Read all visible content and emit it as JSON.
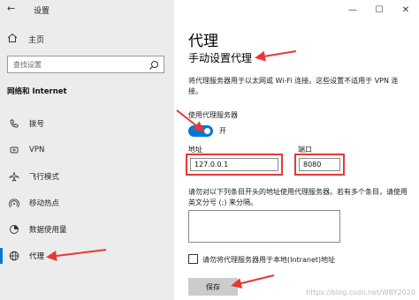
{
  "window": {
    "app_title": "设置",
    "controls": [
      "minimize-icon",
      "maximize-icon",
      "close-icon"
    ]
  },
  "sidebar": {
    "home_label": "主页",
    "search_placeholder": "查找设置",
    "section_title": "网络和 Internet",
    "items": [
      {
        "label": "拨号",
        "icon": "dialup-icon"
      },
      {
        "label": "VPN",
        "icon": "vpn-icon"
      },
      {
        "label": "飞行模式",
        "icon": "airplane-icon"
      },
      {
        "label": "移动热点",
        "icon": "hotspot-icon"
      },
      {
        "label": "数据使用量",
        "icon": "data-usage-icon"
      },
      {
        "label": "代理",
        "icon": "globe-icon",
        "active": true
      }
    ]
  },
  "main": {
    "title": "代理",
    "subtitle": "手动设置代理",
    "description": "将代理服务器用于以太网或 Wi-Fi 连接。这些设置不适用于 VPN 连接。",
    "use_proxy_label": "使用代理服务器",
    "toggle_state": "开",
    "toggle_on": true,
    "address_label": "地址",
    "address_value": "127.0.0.1",
    "port_label": "端口",
    "port_value": "8080",
    "exceptions_label": "请勿对以下列条目开头的地址使用代理服务器。若有多个条目，请使用英文分号 (;) 来分隔。",
    "exceptions_value": "",
    "local_checkbox_label": "请勿将代理服务器用于本地(Intranet)地址",
    "local_checked": false,
    "save_label": "保存",
    "watermark": "https://blog.csdn.net/WBY2020"
  },
  "colors": {
    "accent": "#0078d7",
    "highlight": "#e53935",
    "sidebar_bg": "#ececec"
  }
}
